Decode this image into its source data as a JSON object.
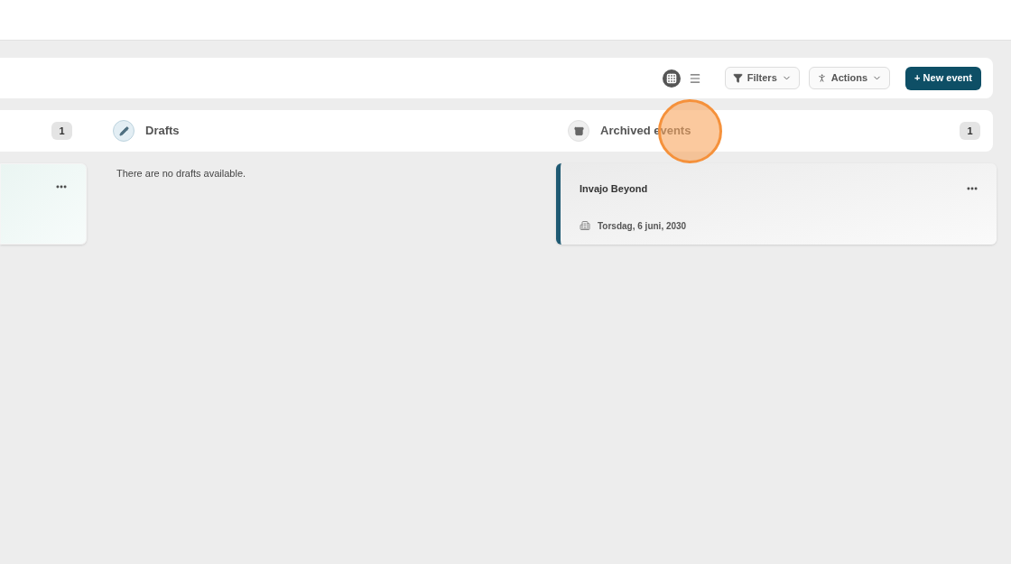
{
  "toolbar": {
    "views": [
      {
        "kind": "grid",
        "selected": true
      },
      {
        "kind": "list",
        "selected": false
      }
    ],
    "filters": "Filters",
    "actions": "Actions",
    "new_event": "+ New event"
  },
  "columns": [
    {
      "kind": "partial",
      "count": "1",
      "cards": [
        {
          "kind": "blank"
        }
      ]
    },
    {
      "kind": "drafts",
      "title": "Drafts",
      "empty_text": "There are no drafts available."
    },
    {
      "kind": "archived",
      "title": "Archived events",
      "count": "1",
      "cards": [
        {
          "kind": "event",
          "title": "Invajo Beyond",
          "date": "Torsdag, 6 juni, 2030"
        }
      ]
    }
  ]
}
